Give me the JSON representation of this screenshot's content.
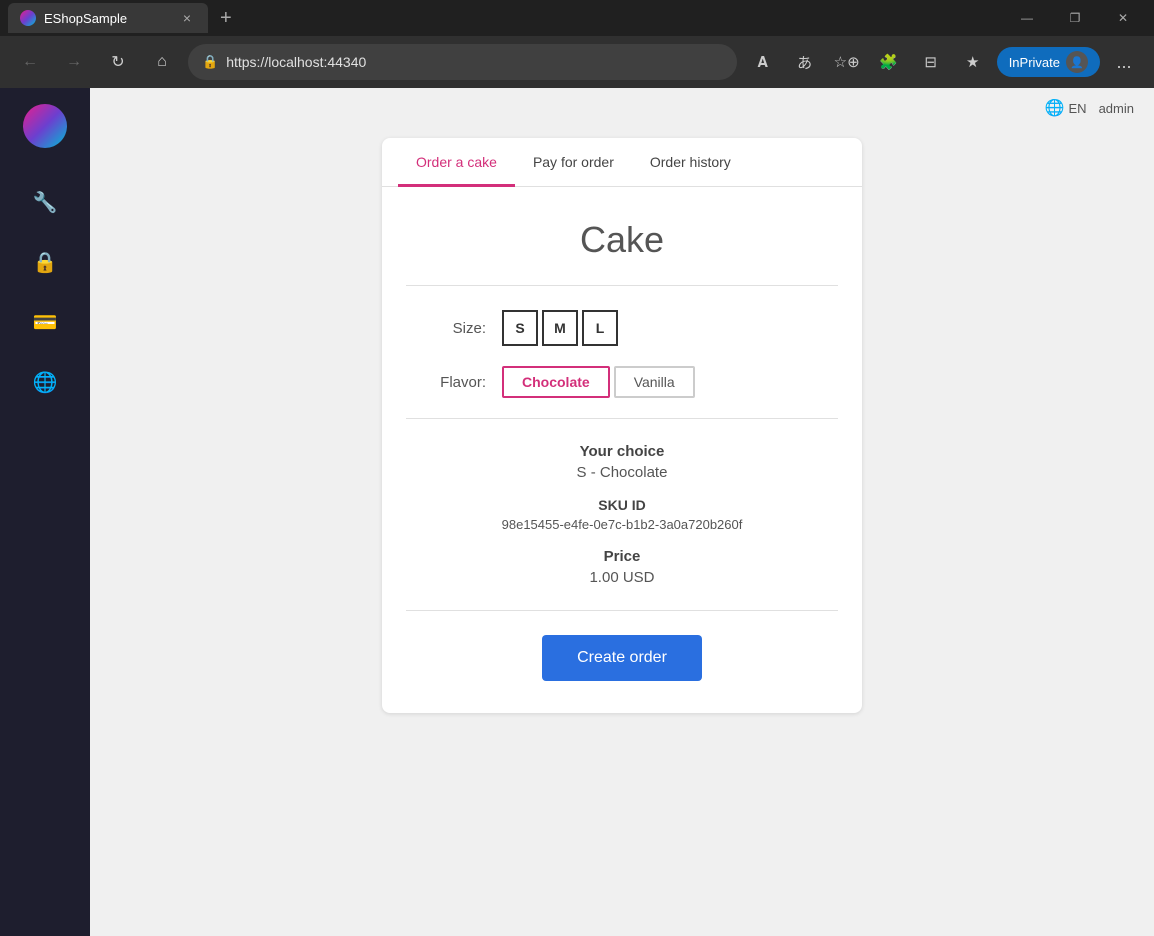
{
  "browser": {
    "tab_title": "EShopSample",
    "tab_close": "×",
    "tab_new": "+",
    "address": "https://localhost:44340",
    "win_minimize": "—",
    "win_restore": "❐",
    "win_close": "✕",
    "inprivate_label": "InPrivate",
    "more_label": "...",
    "back_icon": "←",
    "forward_icon": "→",
    "home_icon": "⌂",
    "refresh_icon": "↻"
  },
  "header": {
    "lang": "EN",
    "user": "admin"
  },
  "tabs": [
    {
      "label": "Order a cake",
      "active": true
    },
    {
      "label": "Pay for order",
      "active": false
    },
    {
      "label": "Order history",
      "active": false
    }
  ],
  "cake": {
    "title": "Cake",
    "size_label": "Size:",
    "flavor_label": "Flavor:",
    "sizes": [
      "S",
      "M",
      "L"
    ],
    "selected_size": "S",
    "flavors": [
      "Chocolate",
      "Vanilla"
    ],
    "selected_flavor": "Chocolate",
    "your_choice_label": "Your choice",
    "choice_value": "S  -   Chocolate",
    "sku_label": "SKU ID",
    "sku_value": "98e15455-e4fe-0e7c-b1b2-3a0a720b260f",
    "price_label": "Price",
    "price_value": "1.00 USD",
    "create_order_label": "Create order"
  },
  "sidebar": {
    "items": [
      {
        "icon": "🔧",
        "name": "tools"
      },
      {
        "icon": "🔒",
        "name": "security"
      },
      {
        "icon": "💳",
        "name": "payments"
      },
      {
        "icon": "🌐",
        "name": "globe"
      }
    ]
  }
}
